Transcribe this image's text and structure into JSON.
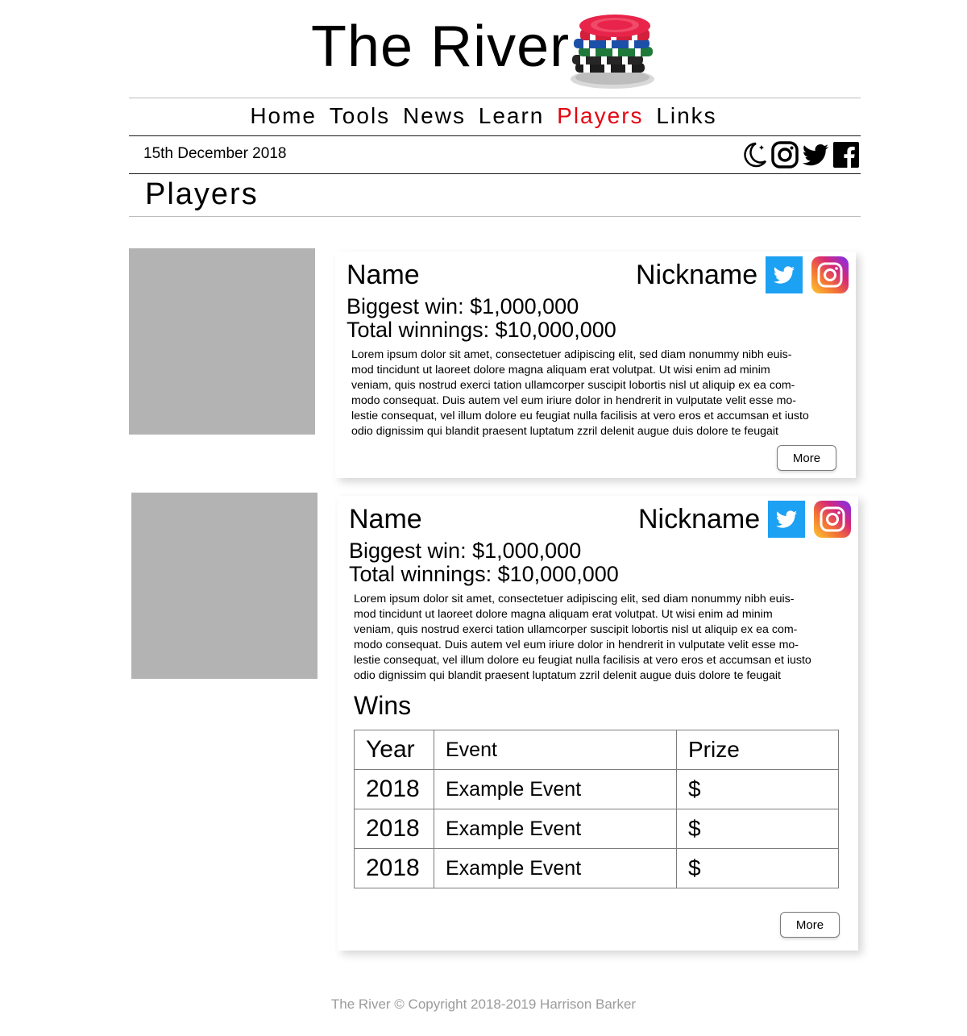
{
  "site": {
    "title": "The River"
  },
  "nav": {
    "items": [
      "Home",
      "Tools",
      "News",
      "Learn",
      "Players",
      "Links"
    ],
    "active": "Players",
    "active_color": "#e30613"
  },
  "date": "15th December 2018",
  "header_icons": [
    "moon-icon",
    "instagram-icon",
    "twitter-icon",
    "facebook-icon"
  ],
  "page_title": "Players",
  "players": [
    {
      "name": "Name",
      "nickname": "Nickname",
      "biggest_win": "Biggest win: $1,000,000",
      "total_winnings": "Total winnings: $10,000,000",
      "bio": [
        "Lorem ipsum dolor sit amet, consectetuer adipiscing elit, sed diam nonummy nibh euis-",
        "mod tincidunt ut laoreet dolore magna aliquam erat volutpat. Ut wisi enim ad minim",
        "veniam, quis nostrud exerci tation ullamcorper suscipit lobortis nisl ut aliquip ex ea com-",
        "modo consequat. Duis autem vel eum iriure dolor in hendrerit in vulputate velit esse mo-",
        "lestie consequat, vel illum dolore eu feugiat nulla facilisis at vero eros et accumsan et iusto",
        "odio dignissim qui blandit praesent luptatum zzril delenit augue duis dolore te feugait"
      ],
      "more_label": "More"
    },
    {
      "name": "Name",
      "nickname": "Nickname",
      "biggest_win": "Biggest win: $1,000,000",
      "total_winnings": "Total winnings: $10,000,000",
      "bio": [
        "Lorem ipsum dolor sit amet, consectetuer adipiscing elit, sed diam nonummy nibh euis-",
        "mod tincidunt ut laoreet dolore magna aliquam erat volutpat. Ut wisi enim ad minim",
        "veniam, quis nostrud exerci tation ullamcorper suscipit lobortis nisl ut aliquip ex ea com-",
        "modo consequat. Duis autem vel eum iriure dolor in hendrerit in vulputate velit esse mo-",
        "lestie consequat, vel illum dolore eu feugiat nulla facilisis at vero eros et accumsan et iusto",
        "odio dignissim qui blandit praesent luptatum zzril delenit augue duis dolore te feugait"
      ],
      "wins_title": "Wins",
      "wins_columns": [
        "Year",
        "Event",
        "Prize"
      ],
      "wins_rows": [
        [
          "2018",
          "Example Event",
          "$"
        ],
        [
          "2018",
          "Example Event",
          "$"
        ],
        [
          "2018",
          "Example Event",
          "$"
        ]
      ],
      "more_label": "More"
    }
  ],
  "colors": {
    "twitter": "#1da1f2",
    "photo_placeholder": "#b3b3b3",
    "footer_text": "#9b9b9b"
  },
  "footer": "The River © Copyright 2018-2019 Harrison Barker"
}
